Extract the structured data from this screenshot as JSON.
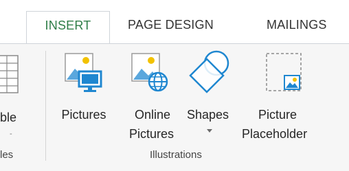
{
  "tabs": [
    {
      "label": "INSERT",
      "active": true
    },
    {
      "label": "PAGE DESIGN",
      "active": false
    },
    {
      "label": "MAILINGS",
      "active": false
    }
  ],
  "partial_group": {
    "button_label_fragment": "ble",
    "dropdown_fragment": "-",
    "group_label_fragment": "les"
  },
  "illustrations": {
    "group_label": "Illustrations",
    "buttons": [
      {
        "label_line1": "Pictures",
        "label_line2": "",
        "icon": "pictures-icon"
      },
      {
        "label_line1": "Online",
        "label_line2": "Pictures",
        "icon": "online-pictures-icon"
      },
      {
        "label_line1": "Shapes",
        "label_line2": "",
        "icon": "shapes-icon",
        "has_dropdown": true
      },
      {
        "label_line1": "Picture",
        "label_line2": "Placeholder",
        "icon": "picture-placeholder-icon"
      }
    ]
  },
  "colors": {
    "accent": "#2e7d47",
    "icon_blue": "#1f87d0",
    "ribbon_bg": "#f6f6f6"
  }
}
